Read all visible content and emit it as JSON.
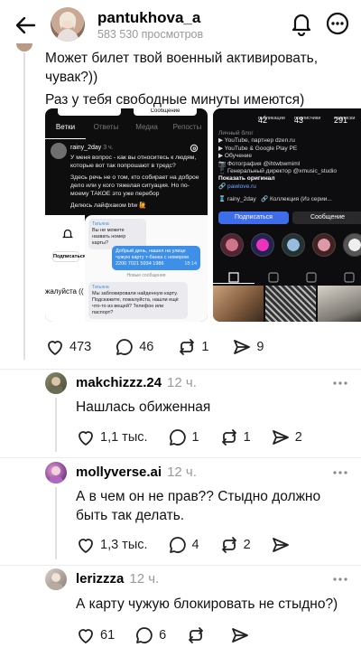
{
  "header": {
    "username": "pantukhova_a",
    "views": "583 530 просмотров"
  },
  "post": {
    "text_line1": "Может билет твой военный активировать, чувак?))",
    "text_line2": "Раз у тебя свободные минуты имеются)",
    "screenshot1": {
      "top_button": "Сообщение",
      "tabs": [
        "Ветки",
        "Ответы",
        "Медиа",
        "Репосты"
      ],
      "author": "rainy_2day",
      "author_time": "3 ч.",
      "para1": "У меня вопрос - как вы относитесь к людям, которые вот так попрошают в тредс?",
      "para2": "Здесь речь не о том, кто собирает на доброе дело или у кого тяжелая ситуация. Но по-моему ТАКОЕ это уже перебор",
      "para3": "Делюсь лайфхаком btw 🙋",
      "msg_sender": "Татьяна",
      "msg1": "Вы не можете назвать номер карты?",
      "msg2": "Добрый день, нашел на улице чужую карту т-банка с номером 2200 7021 5934 1986",
      "msg2_time": "18:14",
      "new_messages": "Новые сообщения",
      "msg3": "Мы заблокировали найденную карту. Подскажите, пожалуйста, нашли ещё что-то из вещей? Телефон или паспорт?",
      "left_btn": "Подписаться",
      "left_text": "жалуйста (("
    },
    "screenshot2": {
      "stats": [
        {
          "num": "42",
          "label": "публикации"
        },
        {
          "num": "43",
          "label": "подписчики"
        },
        {
          "num": "291",
          "label": "подписки"
        }
      ],
      "bio_label": "Личный блог",
      "bio_lines": [
        "▶ YouTube, партнер dzen.ru",
        "▶ YouTube & Google Play PE",
        "▶ Обучение",
        "📷 Фотография @ihtwbwmiml",
        "📱 Генеральный директор @xmusic_studio"
      ],
      "bio_cta": "Показать оригинал",
      "bio_link": "🔗 pawlove.ru",
      "chip1": "🧵 rainy_2day",
      "chip2": "🔗 Коллекция (Из серии...",
      "subscribe": "Подписаться",
      "message": "Сообщение"
    },
    "likes": "473",
    "comments": "46",
    "reposts": "1",
    "shares": "9"
  },
  "replies": [
    {
      "username": "makchizzz.24",
      "time": "12 ч.",
      "text": "Нашлась обиженная",
      "likes": "1,1 тыс.",
      "comments": "1",
      "reposts": "1",
      "shares": "2"
    },
    {
      "username": "mollyverse.ai",
      "time": "12 ч.",
      "text": "А в чем он не прав?? Стыдно должно быть так делать.",
      "likes": "1,3 тыс.",
      "comments": "4",
      "reposts": "2",
      "shares": ""
    },
    {
      "username": "lerizzza",
      "time": "12 ч.",
      "text": "А карту чужую блокировать не стыдно?)",
      "likes": "61",
      "comments": "6",
      "reposts": "",
      "shares": ""
    }
  ]
}
